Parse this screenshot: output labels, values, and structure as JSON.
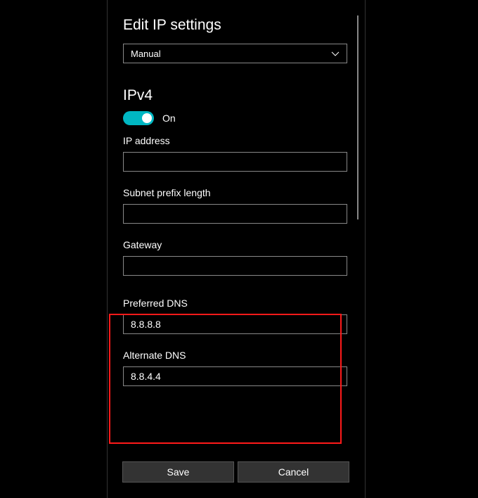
{
  "title": "Edit IP settings",
  "dropdown": {
    "selected": "Manual"
  },
  "ipv4": {
    "heading": "IPv4",
    "toggle_state": "On"
  },
  "fields": {
    "ip_address": {
      "label": "IP address",
      "value": ""
    },
    "subnet": {
      "label": "Subnet prefix length",
      "value": ""
    },
    "gateway": {
      "label": "Gateway",
      "value": ""
    },
    "preferred_dns": {
      "label": "Preferred DNS",
      "value": "8.8.8.8"
    },
    "alternate_dns": {
      "label": "Alternate DNS",
      "value": "8.8.4.4"
    }
  },
  "buttons": {
    "save": "Save",
    "cancel": "Cancel"
  }
}
